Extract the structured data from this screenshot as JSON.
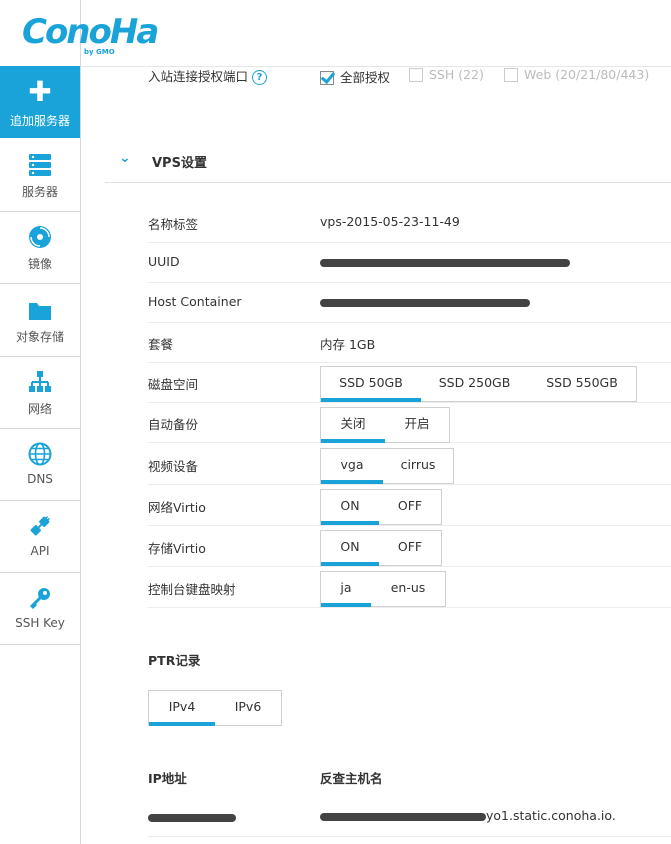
{
  "brand": {
    "name": "ConoHa",
    "sub": "by GMO"
  },
  "sidebar": {
    "add_server": "追加服务器",
    "items": [
      {
        "label": "服务器",
        "icon": "server-icon"
      },
      {
        "label": "镜像",
        "icon": "disc-icon"
      },
      {
        "label": "对象存储",
        "icon": "folder-icon"
      },
      {
        "label": "网络",
        "icon": "network-icon"
      },
      {
        "label": "DNS",
        "icon": "globe-icon"
      },
      {
        "label": "API",
        "icon": "plug-icon"
      },
      {
        "label": "SSH Key",
        "icon": "key-icon"
      }
    ]
  },
  "inbound": {
    "label": "入站连接授权端口",
    "options": [
      {
        "label": "全部授权",
        "checked": true
      },
      {
        "label": "SSH (22)",
        "checked": false
      },
      {
        "label": "Web (20/21/80/443)",
        "checked": false
      }
    ]
  },
  "vps_section": {
    "title": "VPS设置"
  },
  "settings": {
    "name_tag": {
      "label": "名称标签",
      "value": "vps-2015-05-23-11-49"
    },
    "uuid": {
      "label": "UUID"
    },
    "host_container": {
      "label": "Host Container"
    },
    "plan": {
      "label": "套餐",
      "value": "内存 1GB"
    },
    "disk": {
      "label": "磁盘空间",
      "options": [
        "SSD 50GB",
        "SSD 250GB",
        "SSD 550GB"
      ]
    },
    "auto_backup": {
      "label": "自动备份",
      "options": [
        "关闭",
        "开启"
      ]
    },
    "video": {
      "label": "视频设备",
      "options": [
        "vga",
        "cirrus"
      ]
    },
    "net_virtio": {
      "label": "网络Virtio",
      "options": [
        "ON",
        "OFF"
      ]
    },
    "storage_virtio": {
      "label": "存储Virtio",
      "options": [
        "ON",
        "OFF"
      ]
    },
    "keymap": {
      "label": "控制台键盘映射",
      "options": [
        "ja",
        "en-us"
      ]
    }
  },
  "ptr": {
    "title": "PTR记录",
    "tabs": [
      "IPv4",
      "IPv6"
    ],
    "col_ip": "IP地址",
    "col_reverse": "反查主机名",
    "reverse_suffix": "yo1.static.conoha.io."
  },
  "colors": {
    "accent": "#1aa3d8"
  }
}
